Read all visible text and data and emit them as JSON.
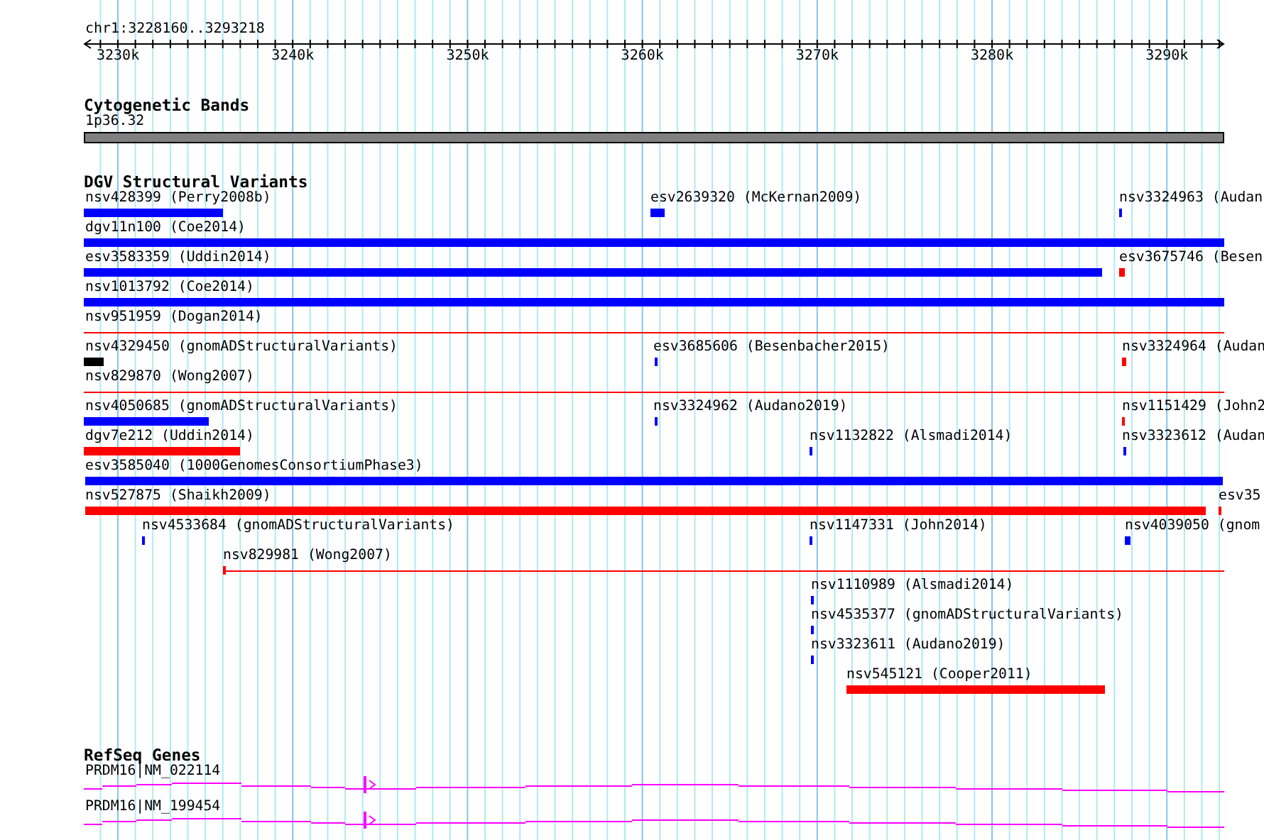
{
  "ruler": {
    "location": "chr1:3228160..3293218",
    "ticks": [
      "3230k",
      "3240k",
      "3250k",
      "3260k",
      "3270k",
      "3280k",
      "3290k"
    ]
  },
  "tracks": [
    {
      "kind": "bands",
      "title": "Cytogenetic Bands",
      "features": [
        {
          "label": "1p36.32"
        }
      ]
    },
    {
      "kind": "variants",
      "title": "DGV Structural Variants",
      "features": [
        {
          "label": "nsv428399 (Perry2008b)",
          "kind": "bar",
          "color": "#0000ff"
        },
        {
          "label": "esv2639320 (McKernan2009)",
          "kind": "bar",
          "color": "#0000ff"
        },
        {
          "label": "nsv3324963 (Audan",
          "kind": "bar",
          "color": "#0000ff"
        },
        {
          "label": "dgv11n100 (Coe2014)",
          "kind": "bar",
          "color": "#0000ff"
        },
        {
          "label": "esv3583359 (Uddin2014)",
          "kind": "bar",
          "color": "#0000ff"
        },
        {
          "label": "esv3675746 (Besen",
          "kind": "bar",
          "color": "#ff0000"
        },
        {
          "label": "nsv1013792 (Coe2014)",
          "kind": "bar",
          "color": "#0000ff"
        },
        {
          "label": "nsv951959 (Dogan2014)",
          "kind": "line",
          "color": "#ff0000"
        },
        {
          "label": "nsv4329450 (gnomADStructuralVariants)",
          "kind": "bar",
          "color": "#000000"
        },
        {
          "label": "esv3685606 (Besenbacher2015)",
          "kind": "bar",
          "color": "#0000ff"
        },
        {
          "label": "nsv3324964 (Audan",
          "kind": "bar",
          "color": "#ff0000"
        },
        {
          "label": "nsv829870 (Wong2007)",
          "kind": "line",
          "color": "#ff0000"
        },
        {
          "label": "nsv4050685 (gnomADStructuralVariants)",
          "kind": "bar",
          "color": "#0000ff"
        },
        {
          "label": "nsv3324962 (Audano2019)",
          "kind": "bar",
          "color": "#0000ff"
        },
        {
          "label": "nsv1151429 (John2",
          "kind": "bar",
          "color": "#ff0000"
        },
        {
          "label": "dgv7e212 (Uddin2014)",
          "kind": "bar",
          "color": "#ff0000"
        },
        {
          "label": "nsv1132822 (Alsmadi2014)",
          "kind": "bar",
          "color": "#0000ff"
        },
        {
          "label": "nsv3323612 (Audan",
          "kind": "bar",
          "color": "#0000ff"
        },
        {
          "label": "esv3585040 (1000GenomesConsortiumPhase3)",
          "kind": "bar",
          "color": "#0000ff"
        },
        {
          "label": "nsv527875 (Shaikh2009)",
          "kind": "bar",
          "color": "#ff0000"
        },
        {
          "label": "esv35",
          "kind": "bar",
          "color": "#ff0000"
        },
        {
          "label": "nsv4533684 (gnomADStructuralVariants)",
          "kind": "bar",
          "color": "#0000ff"
        },
        {
          "label": "nsv1147331 (John2014)",
          "kind": "bar",
          "color": "#0000ff"
        },
        {
          "label": "nsv4039050 (gnom",
          "kind": "bar",
          "color": "#0000ff"
        },
        {
          "label": "nsv829981 (Wong2007)",
          "kind": "line",
          "color": "#ff0000"
        },
        {
          "label": "nsv1110989 (Alsmadi2014)",
          "kind": "bar",
          "color": "#0000ff"
        },
        {
          "label": "nsv4535377 (gnomADStructuralVariants)",
          "kind": "bar",
          "color": "#0000ff"
        },
        {
          "label": "nsv3323611 (Audano2019)",
          "kind": "bar",
          "color": "#0000ff"
        },
        {
          "label": "nsv545121 (Cooper2011)",
          "kind": "bar",
          "color": "#ff0000"
        }
      ]
    },
    {
      "kind": "genes",
      "title": "RefSeq Genes",
      "features": [
        {
          "label": "PRDM16|NM_022114"
        },
        {
          "label": "PRDM16|NM_199454"
        }
      ]
    }
  ]
}
